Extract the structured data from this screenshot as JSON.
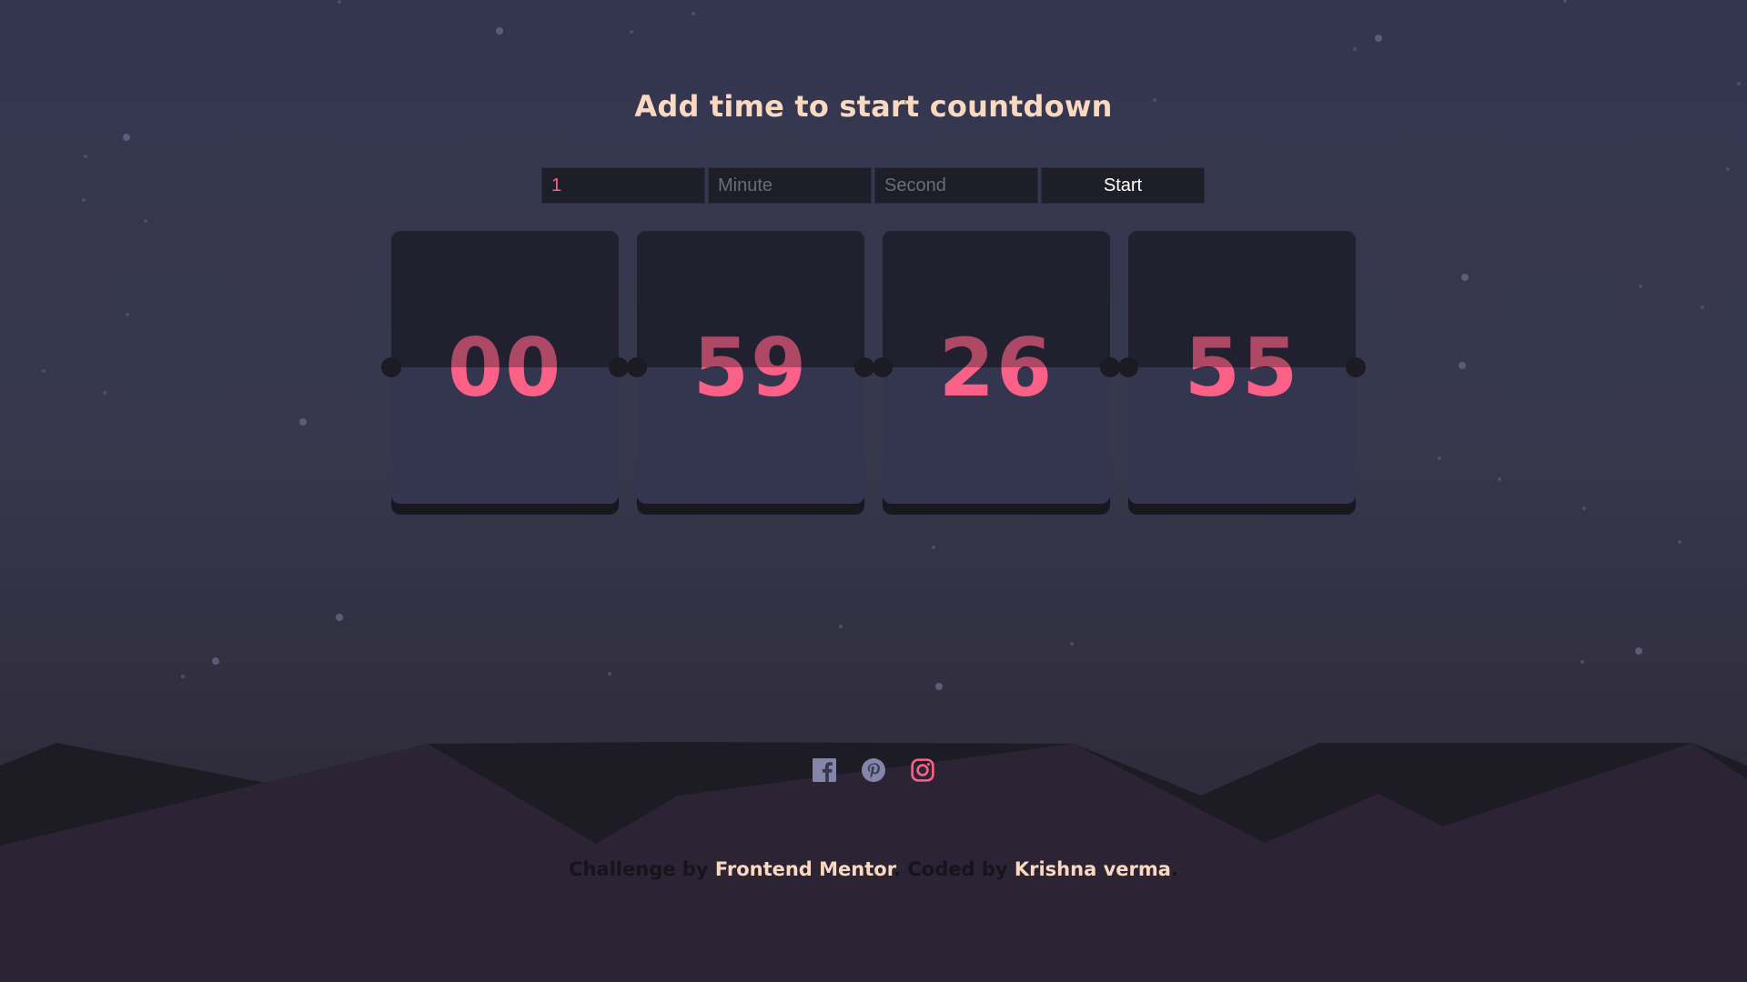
{
  "page": {
    "title": "Add time to start countdown"
  },
  "form": {
    "hour_value": "1",
    "minute_placeholder": "Minute",
    "second_placeholder": "Second",
    "start_label": "Start"
  },
  "countdown": {
    "days": "00",
    "hours": "59",
    "minutes": "26",
    "seconds": "55"
  },
  "social": {
    "icons": [
      "facebook-icon",
      "pinterest-icon",
      "instagram-icon"
    ]
  },
  "footer": {
    "prefix": "Challenge by ",
    "challenge_link": "Frontend Mentor",
    "middle": ". Coded by ",
    "author_link": "Krishna verma",
    "suffix": "."
  },
  "colors": {
    "accent": "#fb6087",
    "title": "#fad9c0",
    "background": "#343650",
    "card_bottom": "#343650",
    "card_top": "#2c2c44",
    "hills": "#2c2435"
  }
}
